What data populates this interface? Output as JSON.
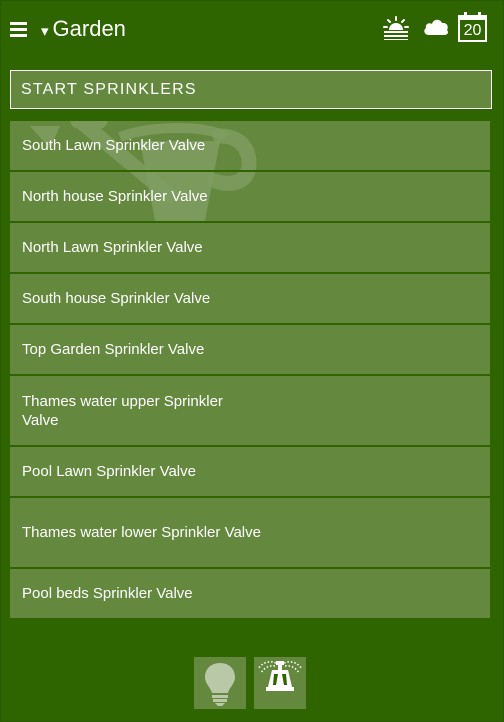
{
  "header": {
    "menu_icon": "hamburger-menu-icon",
    "title_caret": "▾",
    "title": "Garden",
    "icons": [
      "sunrise-icon",
      "cloud-icon",
      "calendar-icon"
    ],
    "calendar_day": "20"
  },
  "start_button": {
    "label": "START SPRINKLERS"
  },
  "list": {
    "watermark_icon": "watering-can-icon",
    "items": [
      {
        "label": "South Lawn Sprinkler Valve"
      },
      {
        "label": "North house Sprinkler Valve"
      },
      {
        "label": "North Lawn Sprinkler Valve"
      },
      {
        "label": "South house Sprinkler Valve"
      },
      {
        "label": "Top Garden Sprinkler Valve"
      },
      {
        "label": "Thames water upper Sprinkler Valve"
      },
      {
        "label": "Pool Lawn Sprinkler Valve"
      },
      {
        "label": "Thames water lower Sprinkler Valve"
      },
      {
        "label": "Pool beds Sprinkler Valve"
      }
    ]
  },
  "bottom_nav": {
    "items": [
      "lightbulb-icon",
      "sprinkler-icon"
    ]
  },
  "colors": {
    "background": "#2f6500",
    "panel": "#63883e",
    "text": "#ffffff"
  }
}
